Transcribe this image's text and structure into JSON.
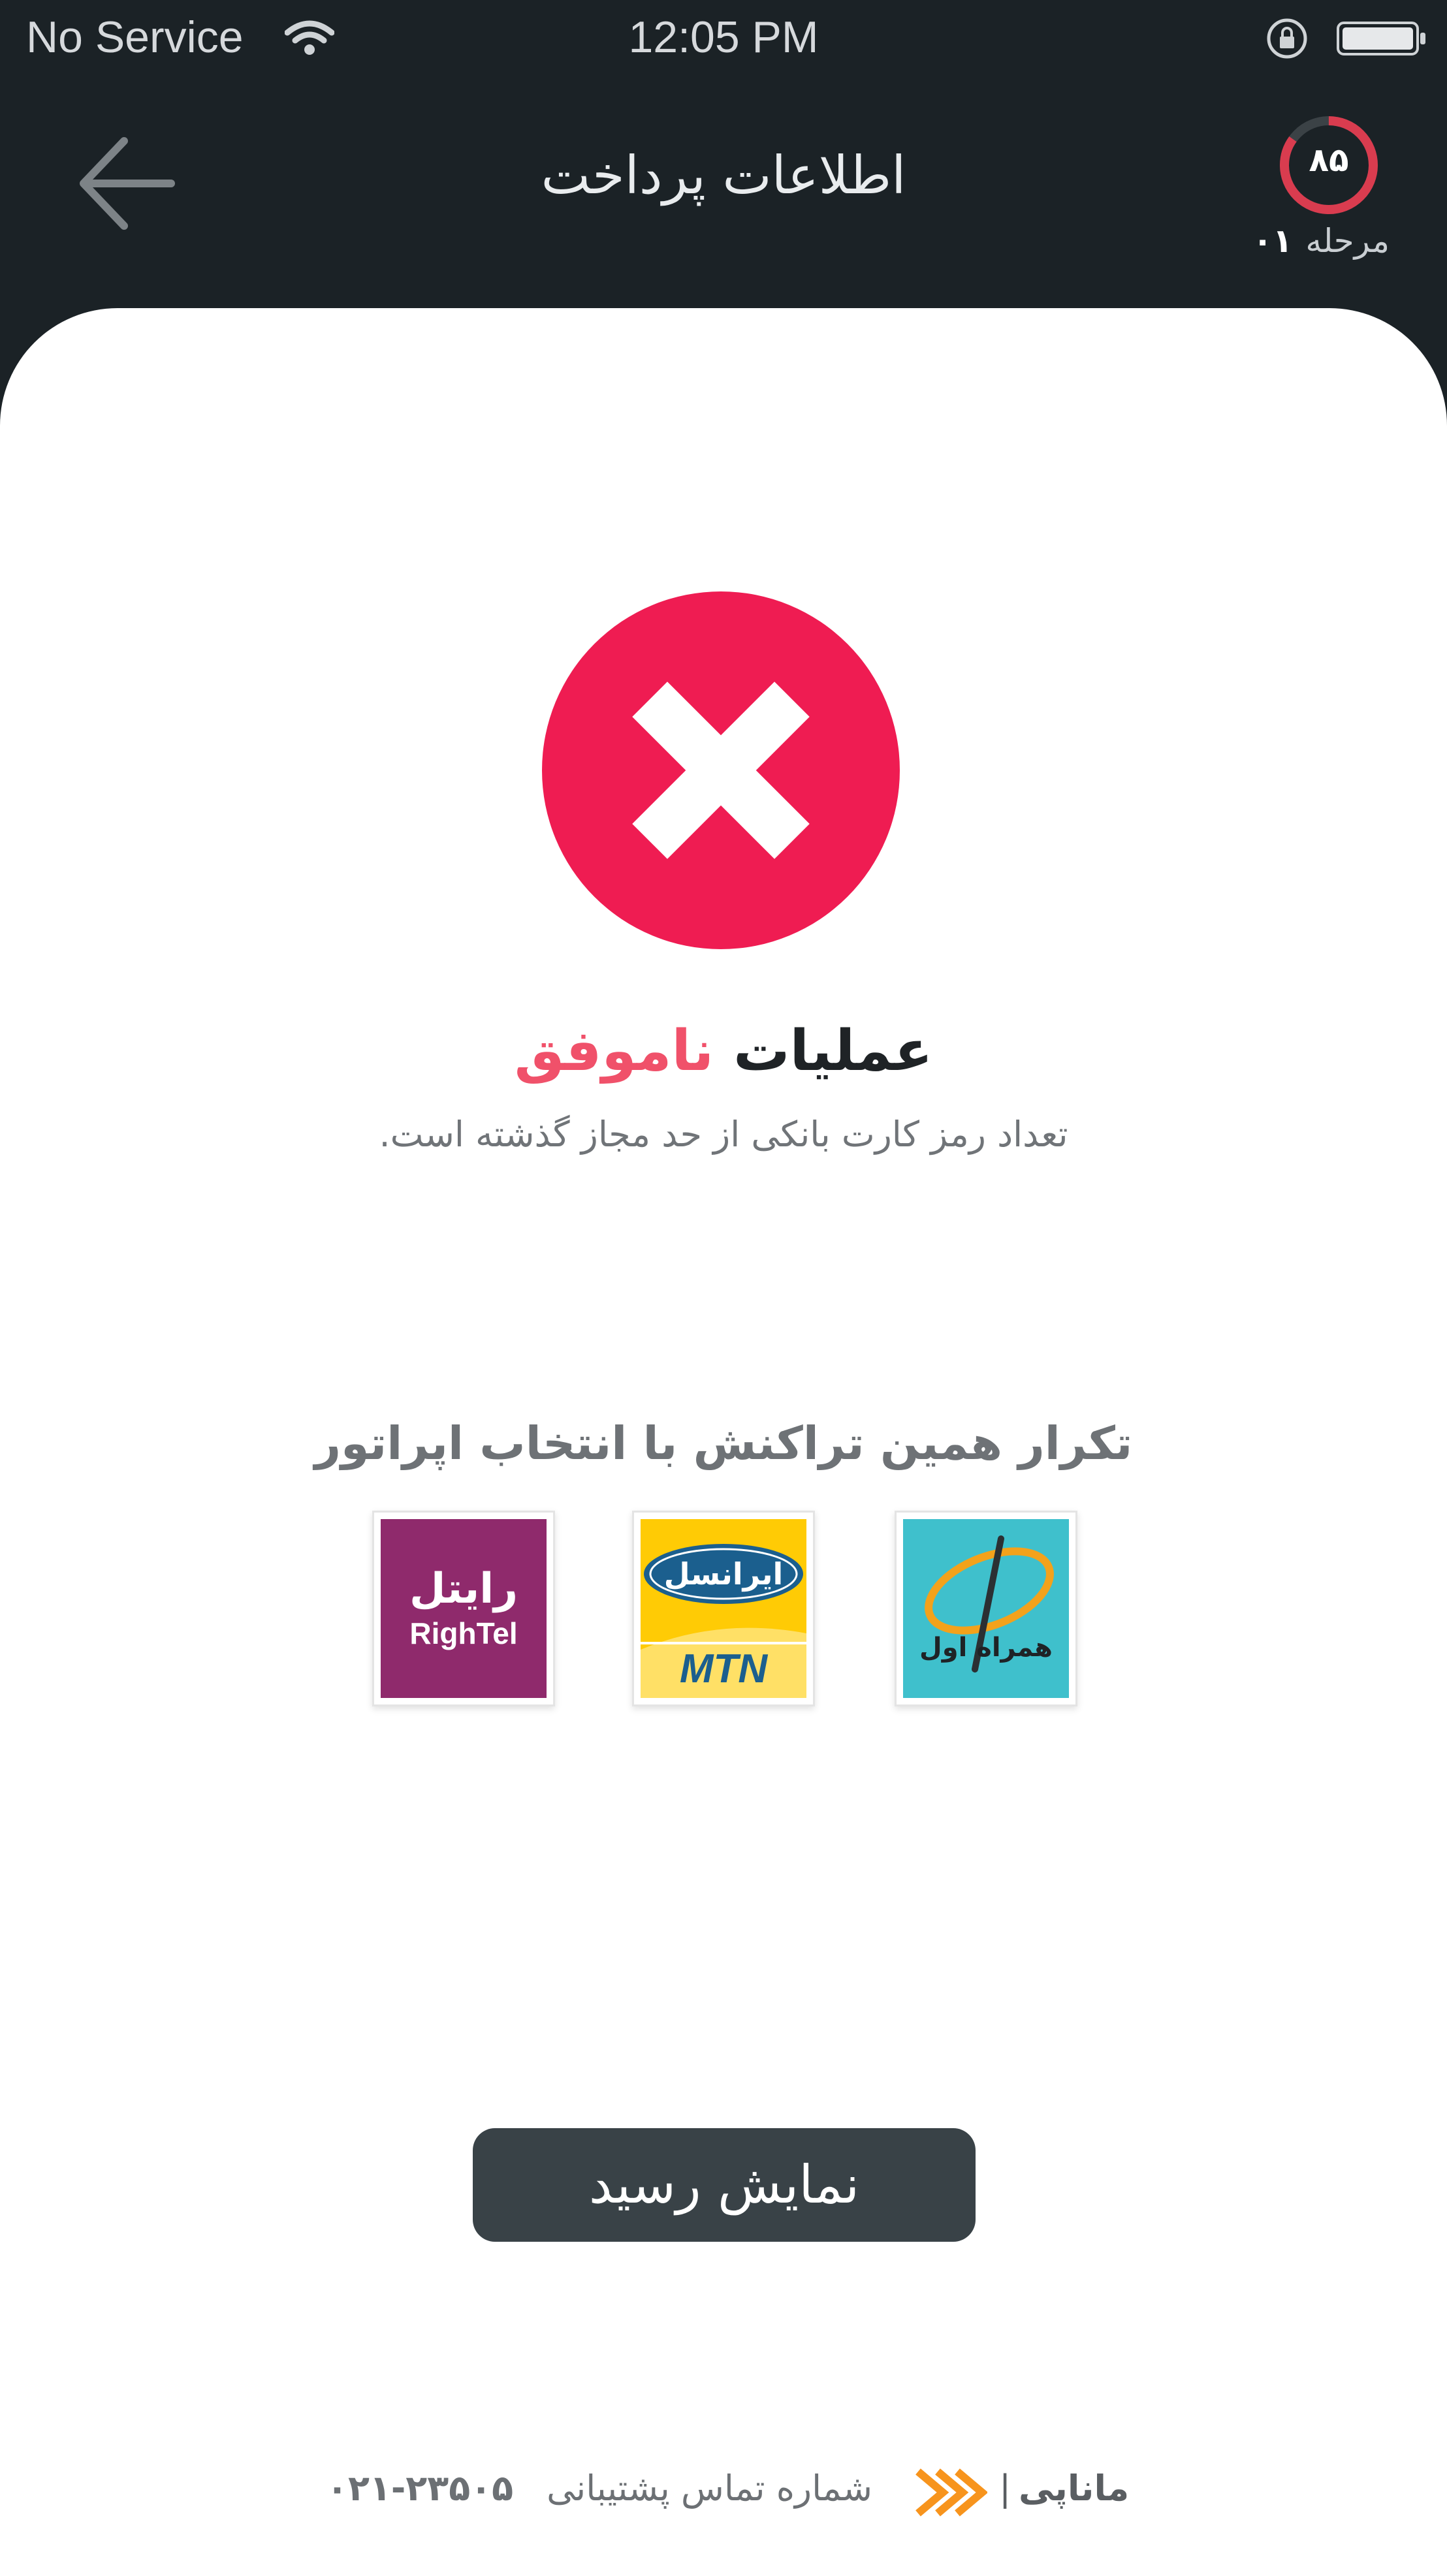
{
  "status_bar": {
    "carrier": "No Service",
    "time": "12:05 PM"
  },
  "header": {
    "title": "اطلاعات پرداخت",
    "progress_value": "۸۵",
    "step_label": "مرحله",
    "step_number": "۰۱"
  },
  "result": {
    "title_prefix": "عملیات",
    "title_status": "ناموفق",
    "description": "تعداد رمز کارت بانکی از حد مجاز گذشته است."
  },
  "retry": {
    "heading": "تکرار همین تراکنش با انتخاب اپراتور",
    "operators": [
      {
        "name": "rightel",
        "logo_text_fa": "رایتل",
        "logo_text_en": "RighTel"
      },
      {
        "name": "irancell",
        "logo_text_fa": "ایرانسل",
        "logo_text_en": "MTN"
      },
      {
        "name": "hamrah-aval",
        "logo_text_fa": "همراه اول"
      }
    ]
  },
  "actions": {
    "show_receipt": "نمایش رسید"
  },
  "footer": {
    "brand": "ماناپی",
    "divider": "|",
    "support_label": "شماره تماس پشتیبانی",
    "phone": "۰۲۱-۲۳۵۰۵"
  },
  "colors": {
    "header_bg": "#1b2226",
    "error_red": "#ef1c52",
    "fail_text": "#f0516a",
    "button_bg": "#394247",
    "brand_orange": "#f7941d"
  },
  "icons": [
    "wifi-icon",
    "lock-rotation-icon",
    "battery-icon",
    "back-arrow-icon",
    "error-x-icon",
    "manapay-logo-icon"
  ]
}
